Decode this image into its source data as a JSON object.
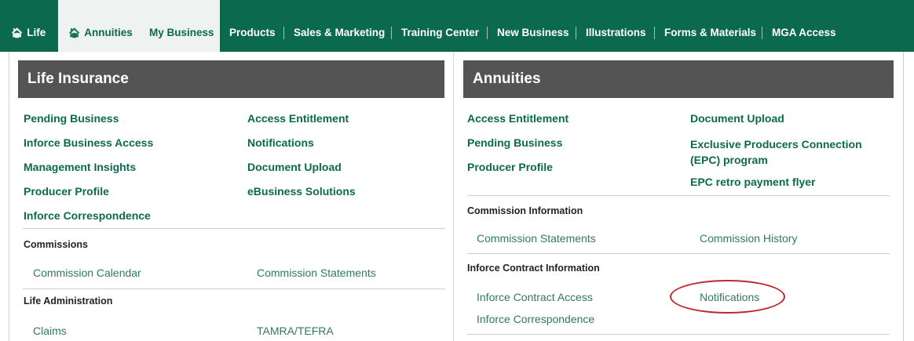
{
  "nav": {
    "items": [
      {
        "label": "Life"
      },
      {
        "label": "Annuities"
      },
      {
        "label": "My Business"
      },
      {
        "label": "Products"
      },
      {
        "label": "Sales & Marketing"
      },
      {
        "label": "Training Center"
      },
      {
        "label": "New Business"
      },
      {
        "label": "Illustrations"
      },
      {
        "label": "Forms & Materials"
      },
      {
        "label": "MGA Access"
      }
    ],
    "home_icon": "home-icon"
  },
  "life": {
    "title": "Life Insurance",
    "links_left": [
      "Pending Business",
      "Inforce Business Access",
      "Management Insights",
      "Producer Profile",
      "Inforce Correspondence"
    ],
    "links_right": [
      "Access Entitlement",
      "Notifications",
      "Document Upload",
      "eBusiness Solutions"
    ],
    "commissions": {
      "heading": "Commissions",
      "links": [
        "Commission Calendar",
        "Commission Statements"
      ]
    },
    "administration": {
      "heading": "Life Administration",
      "links": [
        "Claims",
        "TAMRA/TEFRA"
      ]
    }
  },
  "annuities": {
    "title": "Annuities",
    "links_left": [
      "Access Entitlement",
      "Pending Business",
      "Producer Profile"
    ],
    "links_right": [
      "Document Upload",
      "Exclusive Producers Connection (EPC) program",
      "EPC retro payment flyer"
    ],
    "commission_info": {
      "heading": "Commission Information",
      "links": [
        "Commission Statements",
        "Commission History"
      ]
    },
    "inforce_info": {
      "heading": "Inforce Contract Information",
      "links": [
        "Inforce Contract Access",
        "Notifications",
        "Inforce Correspondence"
      ]
    }
  },
  "colors": {
    "brand_green": "#0c6a4c",
    "header_gray": "#545454",
    "annotation_red": "#c0272d"
  }
}
